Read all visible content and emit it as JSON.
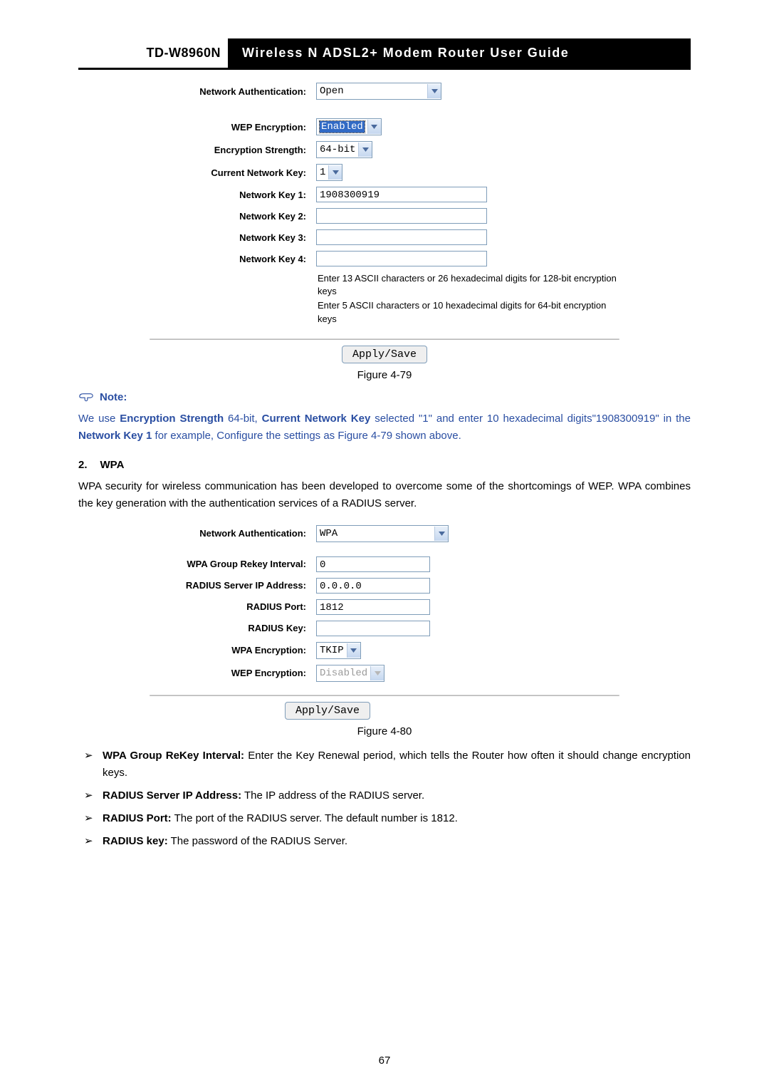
{
  "header": {
    "model": "TD-W8960N",
    "title": "Wireless N ADSL2+ Modem Router User Guide"
  },
  "fig79": {
    "network_auth_label": "Network Authentication:",
    "network_auth_value": "Open",
    "wep_enc_label": "WEP Encryption:",
    "wep_enc_value": "Enabled",
    "enc_strength_label": "Encryption Strength:",
    "enc_strength_value": "64-bit",
    "cur_key_label": "Current Network Key:",
    "cur_key_value": "1",
    "nk1_label": "Network Key 1:",
    "nk1_value": "1908300919",
    "nk2_label": "Network Key 2:",
    "nk2_value": "",
    "nk3_label": "Network Key 3:",
    "nk3_value": "",
    "nk4_label": "Network Key 4:",
    "nk4_value": "",
    "hint1": "Enter 13 ASCII characters or 26 hexadecimal digits for 128-bit encryption keys",
    "hint2": "Enter 5 ASCII characters or 10 hexadecimal digits for 64-bit encryption keys",
    "apply": "Apply/Save",
    "caption": "Figure 4-79"
  },
  "note": {
    "head": "Note:",
    "pre": "We use ",
    "b1": "Encryption Strength",
    "mid1": " 64-bit, ",
    "b2": "Current Network Key",
    "mid2": " selected \"1\" and enter 10 hexadecimal digits\"1908300919\" in the ",
    "b3": "Network Key 1",
    "post": " for example, Configure the settings as Figure 4-79 shown above."
  },
  "wpa": {
    "num": "2.",
    "title": "WPA",
    "para": "WPA security for wireless communication has been developed to overcome some of the shortcomings of WEP. WPA combines the key generation with the authentication services of a RADIUS server."
  },
  "fig80": {
    "network_auth_label": "Network Authentication:",
    "network_auth_value": "WPA",
    "rekey_label": "WPA Group Rekey Interval:",
    "rekey_value": "0",
    "radius_ip_label": "RADIUS Server IP Address:",
    "radius_ip_value": "0.0.0.0",
    "radius_port_label": "RADIUS Port:",
    "radius_port_value": "1812",
    "radius_key_label": "RADIUS Key:",
    "radius_key_value": "",
    "wpa_enc_label": "WPA Encryption:",
    "wpa_enc_value": "TKIP",
    "wep_enc_label": "WEP Encryption:",
    "wep_enc_value": "Disabled",
    "apply": "Apply/Save",
    "caption": "Figure 4-80"
  },
  "bullets": {
    "b1a": "WPA Group ReKey Interval:",
    "b1b": " Enter the Key Renewal period, which tells the Router how often it should change encryption keys.",
    "b2a": "RADIUS Server IP Address:",
    "b2b": " The IP address of the RADIUS server.",
    "b3a": "RADIUS Port:",
    "b3b": " The port of the RADIUS server. The default number is 1812.",
    "b4a": "RADIUS key:",
    "b4b": " The password of the RADIUS Server."
  },
  "page_number": "67"
}
